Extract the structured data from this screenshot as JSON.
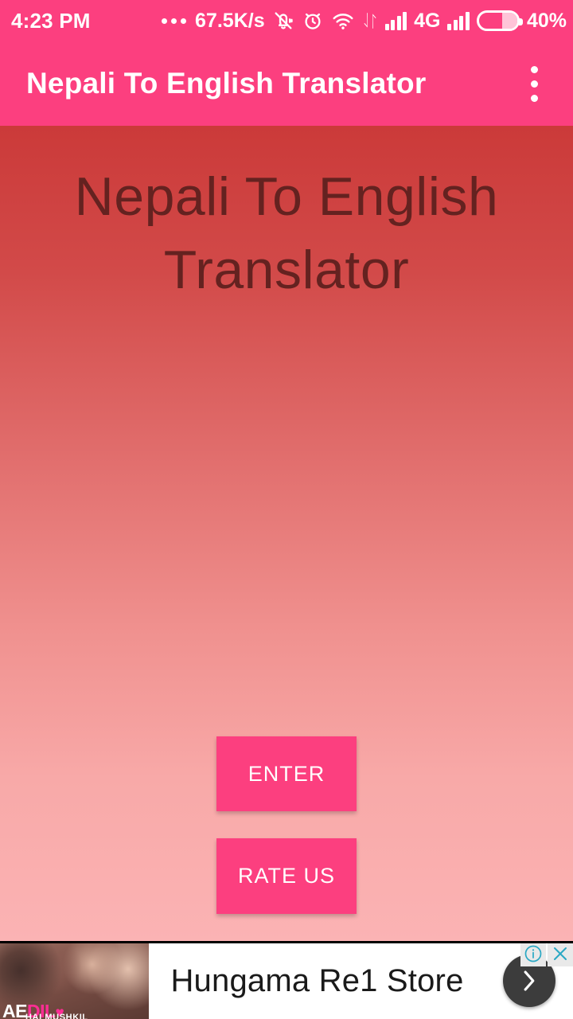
{
  "status_bar": {
    "clock": "4:23 PM",
    "overflow_dots": "...",
    "network_speed": "67.5K/s",
    "mute_icon": "bell-muted-icon",
    "alarm_icon": "alarm-clock-icon",
    "wifi_icon": "wifi-icon",
    "data_transfer_icon": "data-transfer-arrows-icon",
    "signal1_icon": "signal-bars-icon",
    "network_type": "4G",
    "signal2_icon": "signal-bars-icon",
    "battery_icon": "battery-icon",
    "battery_level": "40%",
    "battery_fill_percent": 40,
    "background_color": "#fc3f7f",
    "foreground_color": "#ffffff"
  },
  "app_bar": {
    "title": "Nepali To English Translator",
    "overflow_icon": "more-vertical-icon",
    "background_color": "#fc3f7f",
    "title_color": "#ffffff"
  },
  "main": {
    "hero_title": "Nepali To English Translator",
    "hero_title_color": "#642220",
    "gradient_top_color": "#cb3a39",
    "gradient_bottom_color": "#fbb3b4",
    "buttons": [
      {
        "label": "ENTER",
        "color": "#fc3f7f",
        "text_color": "#ffffff"
      },
      {
        "label": "RATE US",
        "color": "#fc3f7f",
        "text_color": "#ffffff"
      }
    ]
  },
  "ad_banner": {
    "headline": "Hungama Re1 Store",
    "thumbnail_title_word1": "AE",
    "thumbnail_title_word2": "DIL",
    "thumbnail_title_heart": "♥",
    "thumbnail_subtitle": "HAI MUSHKIL",
    "cta_icon": "chevron-right-icon",
    "info_icon": "ad-info-icon",
    "close_icon": "close-icon",
    "badge_color": "#2aa8c4",
    "cta_background": "#3c3c3c",
    "background_color": "#ffffff"
  }
}
